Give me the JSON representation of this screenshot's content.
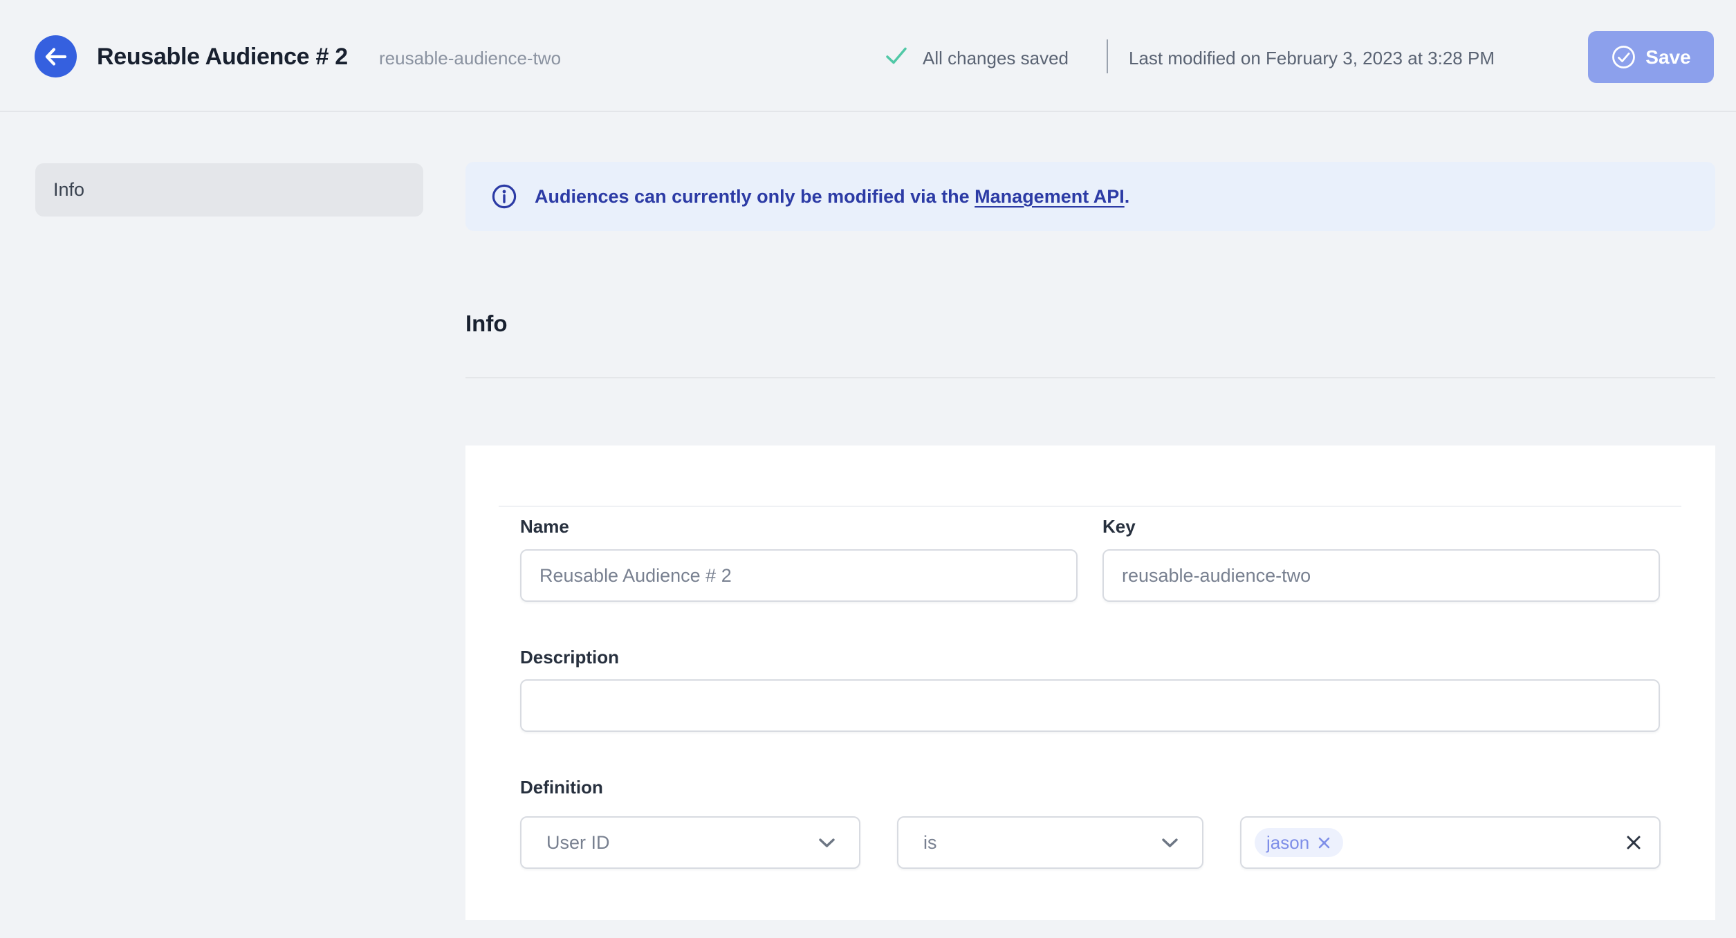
{
  "header": {
    "title": "Reusable Audience # 2",
    "audience_key": "reusable-audience-two",
    "save_status": "All changes saved",
    "last_modified": "Last modified on February 3, 2023 at 3:28 PM",
    "save_button": "Save"
  },
  "sidebar": {
    "items": [
      {
        "label": "Info",
        "active": true
      }
    ]
  },
  "main": {
    "banner": {
      "text": "Audiences can currently only be modified via the ",
      "link": "Management API",
      "suffix": "."
    },
    "section_title": "Info",
    "form": {
      "name": {
        "label": "Name",
        "value": "Reusable Audience # 2"
      },
      "key": {
        "label": "Key",
        "value": "reusable-audience-two"
      },
      "description": {
        "label": "Description",
        "value": ""
      },
      "definition": {
        "label": "Definition",
        "attribute": "User ID",
        "operator": "is",
        "tags": [
          "jason"
        ]
      }
    }
  },
  "colors": {
    "accent_blue": "#3560df",
    "save_button_blue": "#8ca0ec",
    "banner_blue": "#2c3ba5",
    "banner_bg": "#e9f0fb",
    "success_green": "#50c8a6",
    "chip_bg": "#edf1fd",
    "chip_text": "#7e8ee8"
  }
}
